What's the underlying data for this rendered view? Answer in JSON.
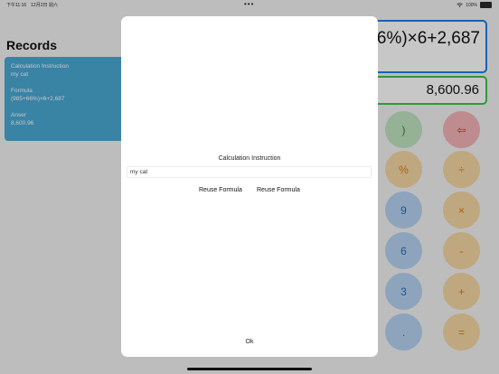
{
  "status_bar": {
    "time": "下午11:16　12月2日 週六",
    "dots": "•••",
    "battery": "100%"
  },
  "records": {
    "title": "Records",
    "card": {
      "instruction_label": "Calculation Instruction",
      "instruction_value": "my cat",
      "formula_label": "Formula",
      "formula_value": "(985+66%)×6+2,687",
      "answer_label": "Anser",
      "answer_value": "8,600.96"
    }
  },
  "calculator": {
    "expression": "66%)×6+2,687",
    "result": "8,600.96",
    "keys": [
      {
        "label": ")",
        "color": "green"
      },
      {
        "label": "⇦",
        "color": "red"
      },
      {
        "label": "%",
        "color": "orange"
      },
      {
        "label": "÷",
        "color": "orange"
      },
      {
        "label": "9",
        "color": "blue"
      },
      {
        "label": "×",
        "color": "orange"
      },
      {
        "label": "6",
        "color": "blue"
      },
      {
        "label": "-",
        "color": "orange"
      },
      {
        "label": "3",
        "color": "blue"
      },
      {
        "label": "+",
        "color": "orange"
      },
      {
        "label": ".",
        "color": "blue"
      },
      {
        "label": "=",
        "color": "orange"
      }
    ]
  },
  "modal": {
    "label": "Calculation Instruction",
    "input_value": "my cat",
    "button_1": "Reuse Formula",
    "button_2": "Reuse Formula",
    "ok": "Ok"
  },
  "colors": {
    "accent_blue": "#1e7fe8",
    "accent_green": "#3ec24a",
    "record_card": "#4aa8d4"
  }
}
